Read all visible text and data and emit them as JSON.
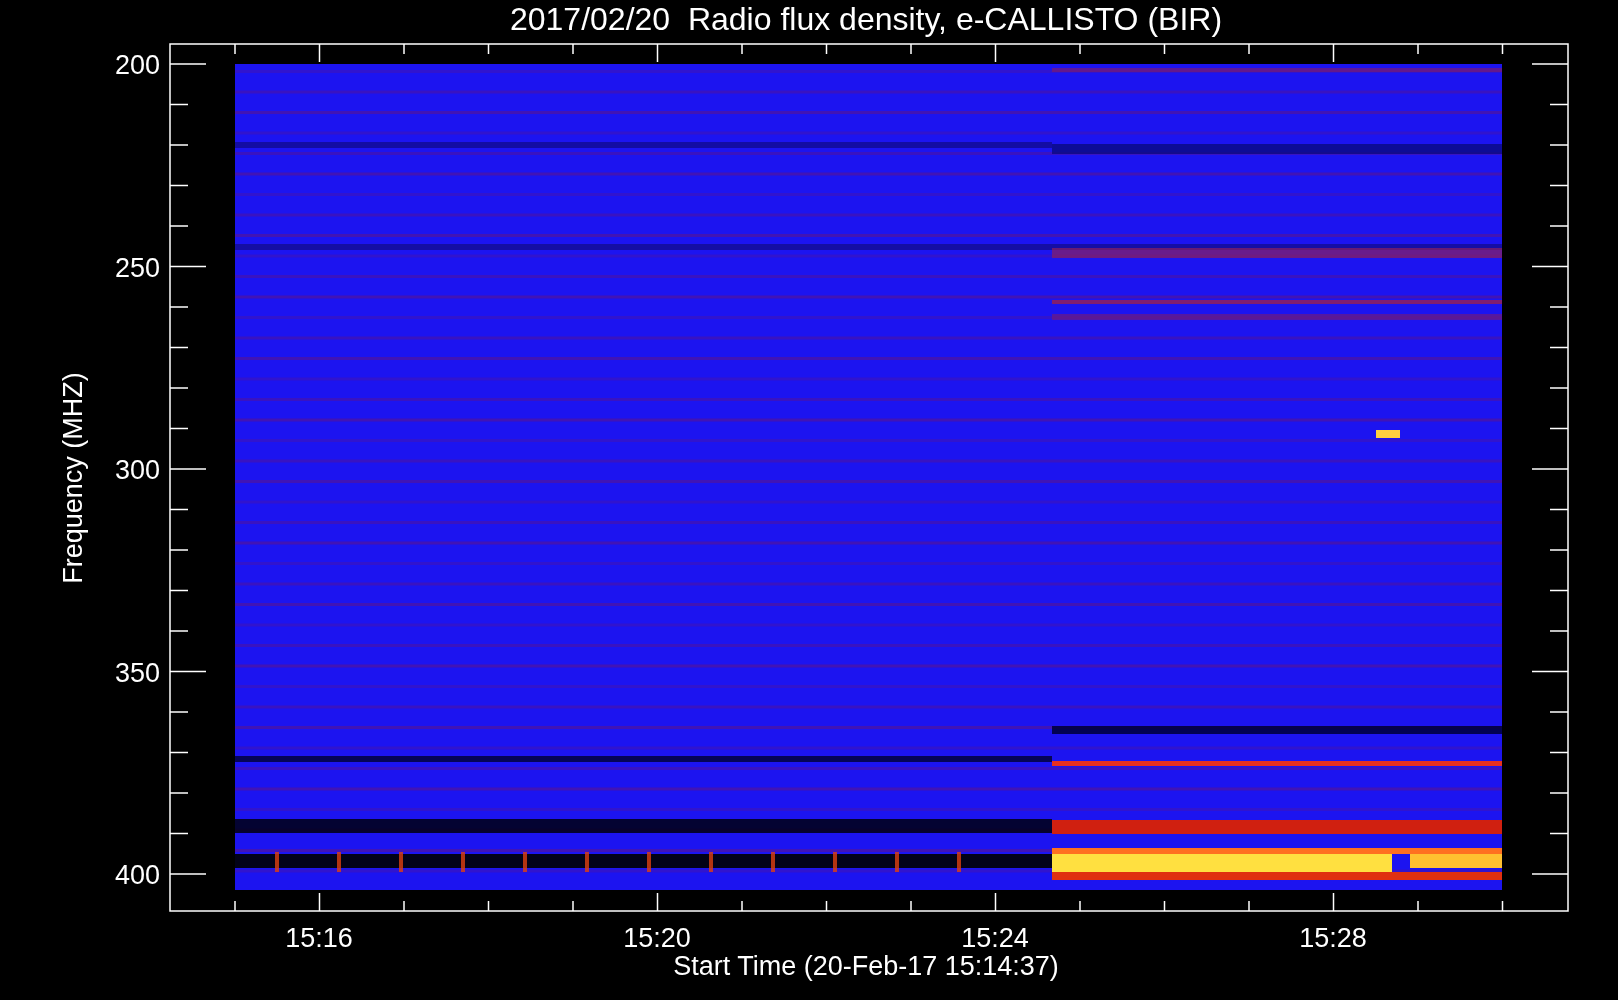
{
  "title": "2017/02/20  Radio flux density, e-CALLISTO (BIR)",
  "y_axis": {
    "label": "Frequency (MHZ)",
    "ticks": [
      "200",
      "250",
      "300",
      "350",
      "400"
    ]
  },
  "x_axis": {
    "label": "Start Time (20-Feb-17 15:14:37)",
    "ticks": [
      "15:16",
      "15:20",
      "15:24",
      "15:28"
    ]
  }
}
